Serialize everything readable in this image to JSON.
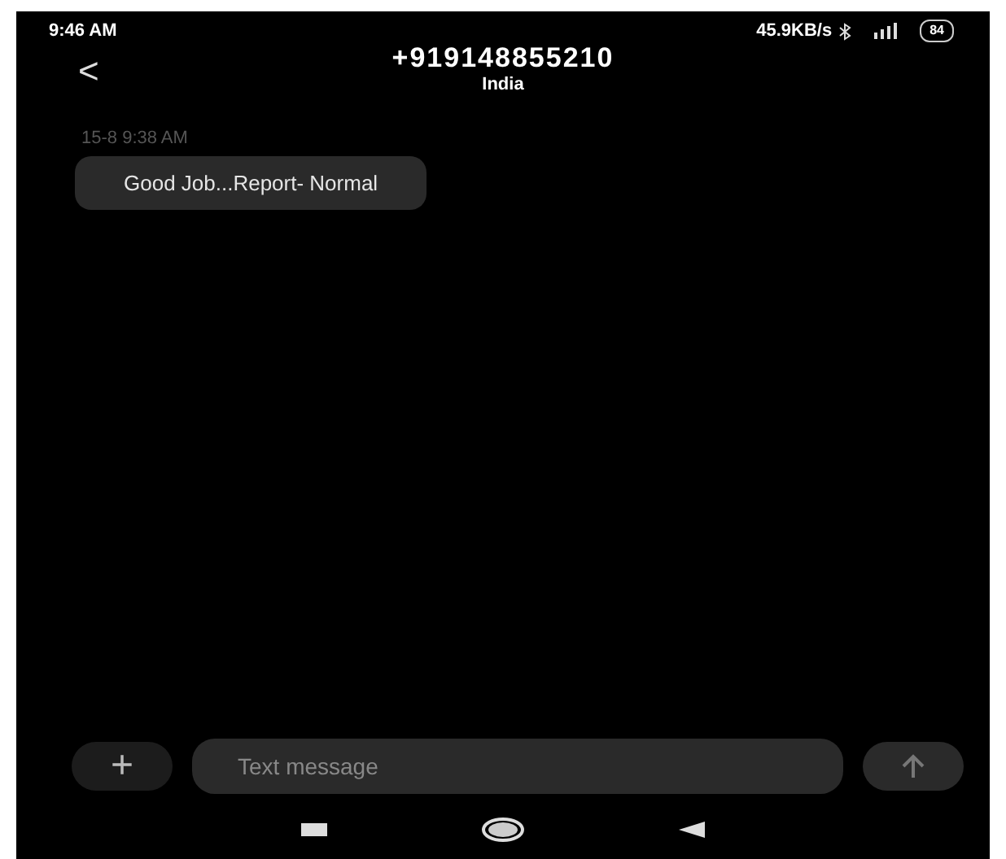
{
  "status_bar": {
    "time": "9:46 AM",
    "speed": "45.9KB/s",
    "battery": "84"
  },
  "header": {
    "back": "<",
    "title": "+919148855210",
    "subtitle": "India"
  },
  "messages": [
    {
      "timestamp": "15-8 9:38 AM",
      "text": "Good Job...Report- Normal"
    }
  ],
  "composer": {
    "add": "+",
    "placeholder": "Text message"
  }
}
